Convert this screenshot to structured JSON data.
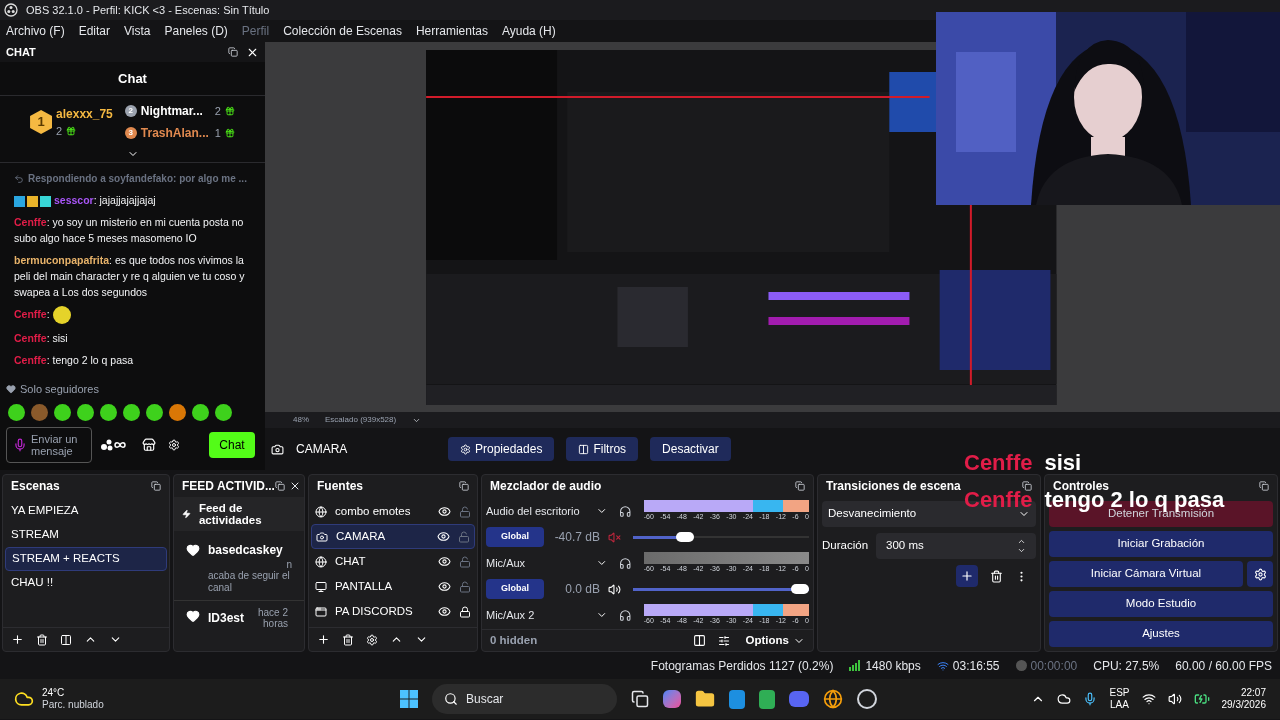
{
  "window": {
    "title": "OBS 32.1.0 - Perfil: KICK <3 - Escenas: Sin Título"
  },
  "menu": [
    {
      "label": "Archivo (F)",
      "disabled": false
    },
    {
      "label": "Editar",
      "disabled": false
    },
    {
      "label": "Vista",
      "disabled": false
    },
    {
      "label": "Paneles (D)",
      "disabled": false
    },
    {
      "label": "Perfil",
      "disabled": true
    },
    {
      "label": "Colección de Escenas",
      "disabled": false
    },
    {
      "label": "Herramientas",
      "disabled": false
    },
    {
      "label": "Ayuda (H)",
      "disabled": false
    }
  ],
  "chat_dock": {
    "title": "CHAT",
    "chat_title": "Chat",
    "leaders": [
      {
        "rank": "1",
        "name": "alexxx_75",
        "count": "2",
        "color": "#f5b942"
      },
      {
        "rank": "2",
        "name": "Nightmar...",
        "count": "2",
        "color": "#9ca3af"
      },
      {
        "rank": "3",
        "name": "TrashAlan...",
        "count": "1",
        "color": "#e0894f"
      }
    ],
    "reply": "Respondiendo a soyfandefako: por algo me ...",
    "messages": [
      {
        "kind": "badged",
        "user": "sesscor",
        "color": "#a855f7",
        "text": ": jajajjajajjajaj"
      },
      {
        "kind": "text",
        "user": "Cenffe",
        "color": "#e11d48",
        "text": ": yo soy un misterio en mi cuenta posta no subo algo hace 5 meses masomeno IO"
      },
      {
        "kind": "text",
        "user": "bermuconpapafrita",
        "color": "#e8b36a",
        "text": ": es que todos nos vivimos la peli del main character y re q alguien ve tu coso y swapea a Los dos segundos"
      },
      {
        "kind": "emote",
        "user": "Cenffe",
        "color": "#e11d48",
        "text": ": "
      },
      {
        "kind": "text",
        "user": "Cenffe",
        "color": "#e11d48",
        "text": ": sisi"
      },
      {
        "kind": "text",
        "user": "Cenffe",
        "color": "#e11d48",
        "text": ": tengo 2 lo q pasa"
      }
    ],
    "mode": "Solo seguidores",
    "input": {
      "placeholder": "Enviar un mensaje"
    },
    "send": "Chat"
  },
  "preview": {
    "zoom": "48%",
    "scaling": "Escalado (939x528)"
  },
  "source_toolbar": {
    "source": "CAMARA",
    "buttons": [
      "Propiedades",
      "Filtros",
      "Desactivar"
    ]
  },
  "scenes": {
    "title": "Escenas",
    "items": [
      {
        "label": "YA EMPIEZA",
        "selected": false
      },
      {
        "label": "STREAM",
        "selected": false
      },
      {
        "label": "STREAM + REACTS",
        "selected": true
      },
      {
        "label": "CHAU !!",
        "selected": false
      }
    ]
  },
  "feed": {
    "title": "FEED ACTIVID...",
    "header": "Feed de actividades",
    "items": [
      {
        "user": "basedcaskey",
        "time": "n",
        "text": "acaba de seguir el canal"
      },
      {
        "user": "ID3est",
        "time": "hace 2 horas"
      }
    ]
  },
  "sources": {
    "title": "Fuentes",
    "items": [
      {
        "name": "combo emotes",
        "kind": "browser",
        "visible": true,
        "locked": false,
        "selected": false
      },
      {
        "name": "CAMARA",
        "kind": "camera",
        "visible": true,
        "locked": false,
        "selected": true
      },
      {
        "name": "CHAT",
        "kind": "browser",
        "visible": true,
        "locked": false,
        "selected": false
      },
      {
        "name": "PANTALLA",
        "kind": "display",
        "visible": true,
        "locked": false,
        "selected": false
      },
      {
        "name": "PA DISCORDS",
        "kind": "window",
        "visible": true,
        "locked": true,
        "selected": false
      }
    ]
  },
  "mixer": {
    "title": "Mezclador de audio",
    "rows": [
      {
        "kind": "meter",
        "name": "Audio del escritorio",
        "active": true,
        "level": 1,
        "scale": [
          "-60",
          "-54",
          "-48",
          "-42",
          "-36",
          "-30",
          "-24",
          "-18",
          "-12",
          "-6",
          "0"
        ]
      },
      {
        "kind": "volume",
        "button": "Global",
        "reading": "-40.7 dB",
        "muted": true,
        "level": 0.27
      },
      {
        "kind": "meter",
        "name": "Mic/Aux",
        "active": false,
        "level": 1,
        "scale": [
          "-60",
          "-54",
          "-48",
          "-42",
          "-36",
          "-30",
          "-24",
          "-18",
          "-12",
          "-6",
          "0"
        ]
      },
      {
        "kind": "volume",
        "button": "Global",
        "reading": "0.0 dB",
        "muted": false,
        "level": 1
      },
      {
        "kind": "meter",
        "name": "Mic/Aux 2",
        "active": true,
        "level": 1,
        "scale": [
          "-60",
          "-54",
          "-48",
          "-42",
          "-36",
          "-30",
          "-24",
          "-18",
          "-12",
          "-6",
          "0"
        ]
      }
    ],
    "hidden": "0 hidden",
    "options": "Options"
  },
  "transitions": {
    "title": "Transiciones de escena",
    "transition": "Desvanecimiento",
    "duration_label": "Duración",
    "duration": "300 ms"
  },
  "controls": {
    "title": "Controles",
    "buttons": [
      {
        "label": "Detener Transmisión",
        "kind": "stop"
      },
      {
        "label": "Iniciar Grabación",
        "kind": "normal"
      },
      {
        "label": "Iniciar Cámara Virtual",
        "kind": "virtual"
      },
      {
        "label": "Modo Estudio",
        "kind": "normal"
      },
      {
        "label": "Ajustes",
        "kind": "normal"
      }
    ]
  },
  "overlay_chat": [
    {
      "user": "Cenffe",
      "color": "#e11d48",
      "text": "sisi"
    },
    {
      "user": "Cenffe",
      "color": "#e11d48",
      "text": "tengo 2 lo q pasa"
    }
  ],
  "status_bar": {
    "dropped": "Fotogramas Perdidos 1127 (0.2%)",
    "bitrate": "1480 kbps",
    "stream_time": "03:16:55",
    "record_time": "00:00:00",
    "cpu": "CPU: 27.5%",
    "fps": "60.00 / 60.00 FPS"
  },
  "taskbar": {
    "temperature": "24°C",
    "weather": "Parc. nublado",
    "search": {
      "placeholder": "Buscar"
    },
    "language": "ESP",
    "layout": "LAA",
    "time": "22:07",
    "date": "29/3/2026"
  }
}
